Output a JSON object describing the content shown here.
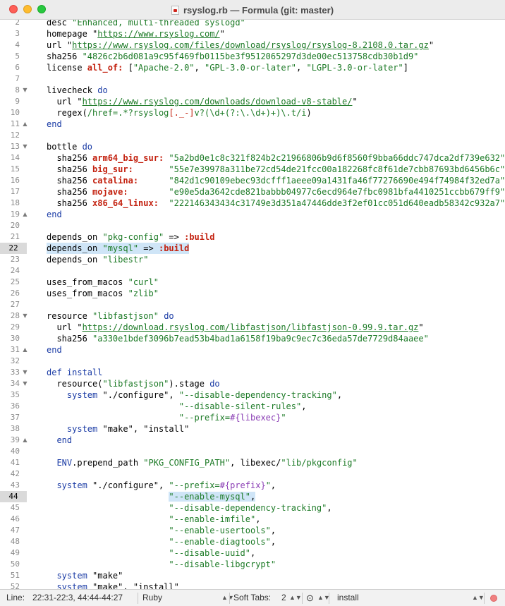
{
  "window": {
    "title": "rsyslog.rb — Formula (git: master)"
  },
  "editor": {
    "current_line": "22",
    "lines": {
      "l2": {
        "n": "2",
        "t1": "desc ",
        "t2": "\"Enhanced, multi-threaded syslogd\""
      },
      "l3": {
        "n": "3",
        "t1": "homepage \"",
        "t2": "https://www.rsyslog.com/",
        "t3": "\""
      },
      "l4": {
        "n": "4",
        "t1": "url \"",
        "t2": "https://www.rsyslog.com/files/download/rsyslog/rsyslog-8.2108.0.tar.gz",
        "t3": "\""
      },
      "l5": {
        "n": "5",
        "t1": "sha256 ",
        "t2": "\"4826c2b6d081a9c95f469fb0115be3f9512065297d3de00ec513758cdb30b1d9\""
      },
      "l6": {
        "n": "6",
        "t1": "license ",
        "t2": "all_of:",
        "t3": " [",
        "t4": "\"Apache-2.0\"",
        "t5": ", ",
        "t6": "\"GPL-3.0-or-later\"",
        "t7": ", ",
        "t8": "\"LGPL-3.0-or-later\"",
        "t9": "]"
      },
      "l7": {
        "n": "7"
      },
      "l8": {
        "n": "8",
        "t1": "livecheck ",
        "t2": "do"
      },
      "l9": {
        "n": "9",
        "t1": "  url \"",
        "t2": "https://www.rsyslog.com/downloads/download-v8-stable/",
        "t3": "\""
      },
      "l10": {
        "n": "10",
        "t1": "  regex(",
        "t2": "/href=.*?rsyslog",
        "t3": "[._-]",
        "t4": "v?(",
        "t5": "\\d",
        "t6": "+(?:",
        "t7": "\\.\\d",
        "t8": "+)+)",
        "t9": "\\.",
        "t10": "t/i",
        "t11": ")"
      },
      "l11": {
        "n": "11",
        "t1": "end"
      },
      "l12": {
        "n": "12"
      },
      "l13": {
        "n": "13",
        "t1": "bottle ",
        "t2": "do"
      },
      "l14": {
        "n": "14",
        "t1": "  sha256 ",
        "t2": "arm64_big_sur:",
        "t3": " \"5a2bd0e1c8c321f824b2c21966806b9d6f8560f9bba66ddc747dca2df739e632\""
      },
      "l15": {
        "n": "15",
        "t1": "  sha256 ",
        "t2": "big_sur:",
        "t3": "       \"55e7e39978a311be72cd54de21fcc00a182268fc8f61de7cbb87693bd6456b6c\""
      },
      "l16": {
        "n": "16",
        "t1": "  sha256 ",
        "t2": "catalina:",
        "t3": "      \"842d1c90109ebec93dcfff1aeee09a1431fa46f77276690e494f74984f32ed7a\""
      },
      "l17": {
        "n": "17",
        "t1": "  sha256 ",
        "t2": "mojave:",
        "t3": "        \"e90e5da3642cde821babbb04977c6ecd964e7fbc0981bfa4410251ccbb679ff9\""
      },
      "l18": {
        "n": "18",
        "t1": "  sha256 ",
        "t2": "x86_64_linux:",
        "t3": "  \"222146343434c31749e3d351a47446dde3f2ef01cc051d640eadb58342c932a7\""
      },
      "l19": {
        "n": "19",
        "t1": "end"
      },
      "l20": {
        "n": "20"
      },
      "l21": {
        "n": "21",
        "t1": "depends_on ",
        "t2": "\"pkg-config\"",
        "t3": " => ",
        "t4": ":build"
      },
      "l22": {
        "n": "22",
        "t1": "depends_on ",
        "t2": "\"mysql\"",
        "t3": " => ",
        "t4": ":build"
      },
      "l23": {
        "n": "23",
        "t1": "depends_on ",
        "t2": "\"libestr\""
      },
      "l24": {
        "n": "24"
      },
      "l25": {
        "n": "25",
        "t1": "uses_from_macos ",
        "t2": "\"curl\""
      },
      "l26": {
        "n": "26",
        "t1": "uses_from_macos ",
        "t2": "\"zlib\""
      },
      "l27": {
        "n": "27"
      },
      "l28": {
        "n": "28",
        "t1": "resource ",
        "t2": "\"libfastjson\"",
        "t3": " ",
        "t4": "do"
      },
      "l29": {
        "n": "29",
        "t1": "  url \"",
        "t2": "https://download.rsyslog.com/libfastjson/libfastjson-0.99.9.tar.gz",
        "t3": "\""
      },
      "l30": {
        "n": "30",
        "t1": "  sha256 ",
        "t2": "\"a330e1bdef3096b7ead53b4bad1a6158f19ba9c9ec7c36eda57de7729d84aaee\""
      },
      "l31": {
        "n": "31",
        "t1": "end"
      },
      "l32": {
        "n": "32"
      },
      "l33": {
        "n": "33",
        "t1": "def ",
        "t2": "install"
      },
      "l34": {
        "n": "34",
        "t1": "  resource(",
        "t2": "\"libfastjson\"",
        "t3": ").stage ",
        "t4": "do"
      },
      "l35": {
        "n": "35",
        "t1": "    ",
        "t2": "system",
        "t3": " \"./configure\", ",
        "t4": "\"--disable-dependency-tracking\"",
        "t5": ","
      },
      "l36": {
        "n": "36",
        "t1": "                          ",
        "t2": "\"--disable-silent-rules\"",
        "t3": ","
      },
      "l37": {
        "n": "37",
        "t1": "                          ",
        "t2": "\"--prefix=",
        "t3": "#{libexec}",
        "t4": "\""
      },
      "l38": {
        "n": "38",
        "t1": "    ",
        "t2": "system",
        "t3": " \"make\", \"install\""
      },
      "l39": {
        "n": "39",
        "t1": "  ",
        "t2": "end"
      },
      "l40": {
        "n": "40"
      },
      "l41": {
        "n": "41",
        "t1": "  ",
        "t2": "ENV",
        "t3": ".prepend_path ",
        "t4": "\"PKG_CONFIG_PATH\"",
        "t5": ", libexec/",
        "t6": "\"lib/pkgconfig\""
      },
      "l42": {
        "n": "42"
      },
      "l43": {
        "n": "43",
        "t1": "  ",
        "t2": "system",
        "t3": " \"./configure\", ",
        "t4": "\"--prefix=",
        "t5": "#{prefix}",
        "t6": "\"",
        "t7": ","
      },
      "l44": {
        "n": "44",
        "t1": "                        ",
        "t2": "\"--enable-mysql\"",
        "t3": ","
      },
      "l45": {
        "n": "45",
        "t1": "                        ",
        "t2": "\"--disable-dependency-tracking\"",
        "t3": ","
      },
      "l46": {
        "n": "46",
        "t1": "                        ",
        "t2": "\"--enable-imfile\"",
        "t3": ","
      },
      "l47": {
        "n": "47",
        "t1": "                        ",
        "t2": "\"--enable-usertools\"",
        "t3": ","
      },
      "l48": {
        "n": "48",
        "t1": "                        ",
        "t2": "\"--enable-diagtools\"",
        "t3": ","
      },
      "l49": {
        "n": "49",
        "t1": "                        ",
        "t2": "\"--disable-uuid\"",
        "t3": ","
      },
      "l50": {
        "n": "50",
        "t1": "                        ",
        "t2": "\"--disable-libgcrypt\""
      },
      "l51": {
        "n": "51",
        "t1": "  ",
        "t2": "system",
        "t3": " \"make\""
      },
      "l52": {
        "n": "52",
        "t1": "  ",
        "t2": "system",
        "t3": " \"make\", \"install\""
      }
    }
  },
  "statusbar": {
    "position_label": "Line:",
    "position": "22:31-22:3, 44:44-44:27",
    "language": "Ruby",
    "tabs_label": "Soft Tabs:",
    "tab_size": "2",
    "symbol": "install",
    "ellipsis_icon": "ellipsis-circle-icon",
    "record_icon": "record-dot-icon"
  },
  "colors": {
    "string": "#1c7a26",
    "keyword": "#1a3ba5",
    "symbol": "#c3210f",
    "selection": "#cfe5f7"
  }
}
